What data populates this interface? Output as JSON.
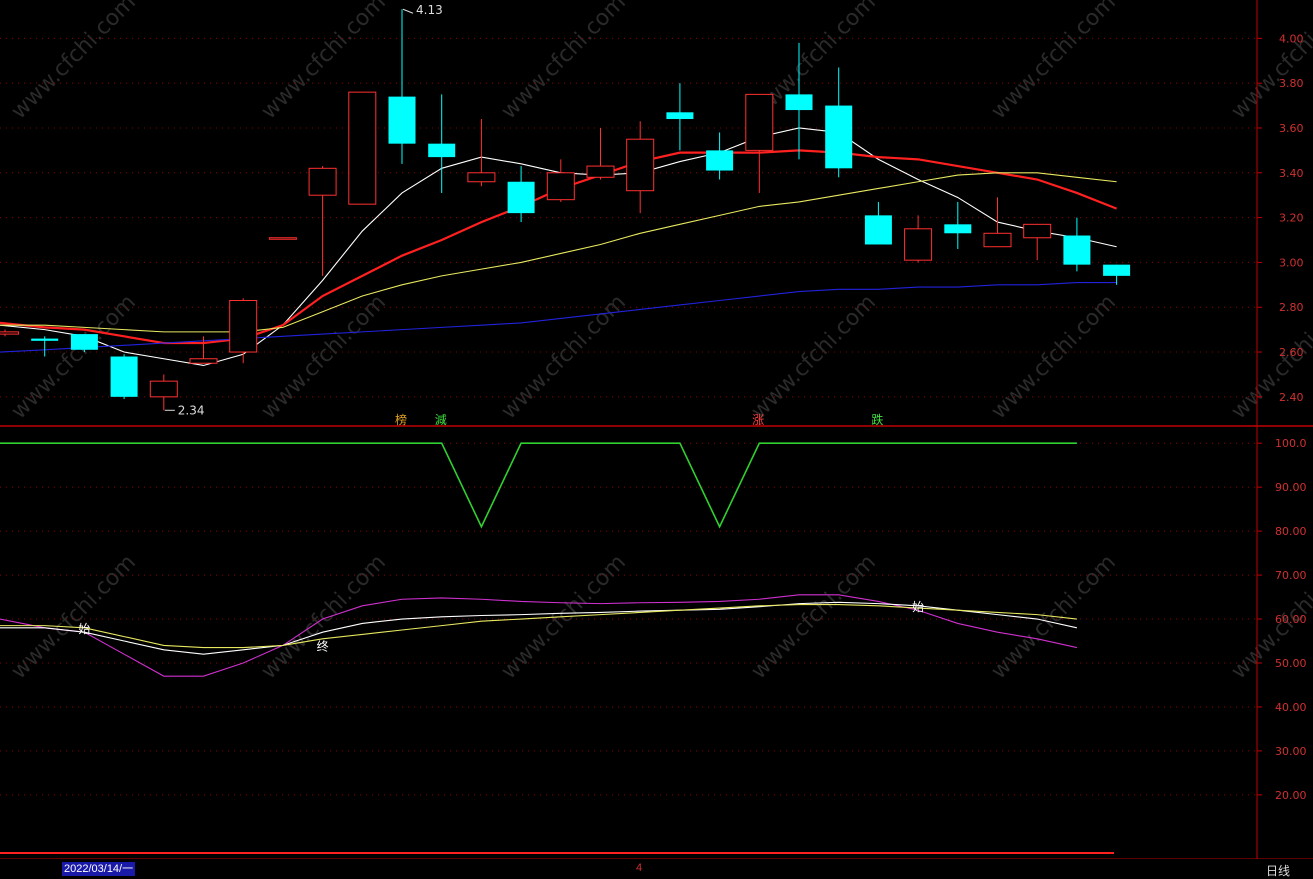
{
  "chart_data": {
    "type": "candlestick",
    "price_axis": {
      "ticks": [
        "4.00",
        "3.80",
        "3.60",
        "3.40",
        "3.20",
        "3.00",
        "2.80",
        "2.60",
        "2.40"
      ],
      "ylim": [
        2.31,
        4.14
      ]
    },
    "indicator_axis": {
      "ticks": [
        "100.0",
        "90.00",
        "80.00",
        "70.00",
        "60.00",
        "50.00",
        "40.00",
        "30.00",
        "20.00"
      ],
      "ylim": [
        7,
        103
      ]
    },
    "candles": [
      {
        "o": 2.68,
        "c": 2.69,
        "h": 2.7,
        "l": 2.67
      },
      {
        "o": 2.66,
        "c": 2.65,
        "h": 2.67,
        "l": 2.58
      },
      {
        "o": 2.68,
        "c": 2.61,
        "h": 2.68,
        "l": 2.6
      },
      {
        "o": 2.58,
        "c": 2.4,
        "h": 2.59,
        "l": 2.39
      },
      {
        "o": 2.4,
        "c": 2.47,
        "h": 2.5,
        "l": 2.34
      },
      {
        "o": 2.55,
        "c": 2.57,
        "h": 2.67,
        "l": 2.55
      },
      {
        "o": 2.6,
        "c": 2.83,
        "h": 2.84,
        "l": 2.55
      },
      {
        "o": 3.11,
        "c": 3.11,
        "h": 3.11,
        "l": 3.11
      },
      {
        "o": 3.3,
        "c": 3.42,
        "h": 3.43,
        "l": 2.94
      },
      {
        "o": 3.26,
        "c": 3.76,
        "h": 3.76,
        "l": 3.26
      },
      {
        "o": 3.74,
        "c": 3.53,
        "h": 4.13,
        "l": 3.44
      },
      {
        "o": 3.53,
        "c": 3.47,
        "h": 3.75,
        "l": 3.31
      },
      {
        "o": 3.36,
        "c": 3.4,
        "h": 3.64,
        "l": 3.34
      },
      {
        "o": 3.36,
        "c": 3.22,
        "h": 3.43,
        "l": 3.18
      },
      {
        "o": 3.28,
        "c": 3.4,
        "h": 3.46,
        "l": 3.27
      },
      {
        "o": 3.38,
        "c": 3.43,
        "h": 3.6,
        "l": 3.37
      },
      {
        "o": 3.32,
        "c": 3.55,
        "h": 3.63,
        "l": 3.22
      },
      {
        "o": 3.67,
        "c": 3.64,
        "h": 3.8,
        "l": 3.5
      },
      {
        "o": 3.5,
        "c": 3.41,
        "h": 3.58,
        "l": 3.37
      },
      {
        "o": 3.5,
        "c": 3.75,
        "h": 3.75,
        "l": 3.31
      },
      {
        "o": 3.75,
        "c": 3.68,
        "h": 3.98,
        "l": 3.46
      },
      {
        "o": 3.7,
        "c": 3.42,
        "h": 3.87,
        "l": 3.38
      },
      {
        "o": 3.21,
        "c": 3.08,
        "h": 3.27,
        "l": 3.08
      },
      {
        "o": 3.01,
        "c": 3.15,
        "h": 3.21,
        "l": 3.0
      },
      {
        "o": 3.17,
        "c": 3.13,
        "h": 3.27,
        "l": 3.06
      },
      {
        "o": 3.07,
        "c": 3.13,
        "h": 3.29,
        "l": 3.07
      },
      {
        "o": 3.11,
        "c": 3.17,
        "h": 3.17,
        "l": 3.01
      },
      {
        "o": 3.12,
        "c": 2.99,
        "h": 3.2,
        "l": 2.96
      },
      {
        "o": 2.99,
        "c": 2.94,
        "h": 2.99,
        "l": 2.9
      }
    ],
    "moving_averages": [
      {
        "color": "#ffffff",
        "values": [
          2.72,
          2.7,
          2.67,
          2.6,
          2.57,
          2.54,
          2.59,
          2.72,
          2.92,
          3.14,
          3.31,
          3.42,
          3.47,
          3.44,
          3.4,
          3.39,
          3.4,
          3.45,
          3.49,
          3.56,
          3.6,
          3.58,
          3.46,
          3.37,
          3.29,
          3.18,
          3.14,
          3.11,
          3.07
        ]
      },
      {
        "color": "#ff2020",
        "values": [
          2.73,
          2.71,
          2.7,
          2.67,
          2.64,
          2.64,
          2.66,
          2.72,
          2.85,
          2.94,
          3.03,
          3.1,
          3.18,
          3.25,
          3.33,
          3.39,
          3.45,
          3.49,
          3.49,
          3.49,
          3.5,
          3.49,
          3.47,
          3.46,
          3.43,
          3.4,
          3.37,
          3.31,
          3.24
        ]
      },
      {
        "color": "#e8e860",
        "values": [
          2.72,
          2.72,
          2.71,
          2.7,
          2.69,
          2.69,
          2.69,
          2.71,
          2.78,
          2.85,
          2.9,
          2.94,
          2.97,
          3.0,
          3.04,
          3.08,
          3.13,
          3.17,
          3.21,
          3.25,
          3.27,
          3.3,
          3.33,
          3.36,
          3.39,
          3.4,
          3.4,
          3.38,
          3.36
        ]
      },
      {
        "color": "#2222dd",
        "values": [
          2.6,
          2.61,
          2.62,
          2.63,
          2.64,
          2.65,
          2.66,
          2.67,
          2.68,
          2.69,
          2.7,
          2.71,
          2.72,
          2.73,
          2.75,
          2.77,
          2.79,
          2.81,
          2.83,
          2.85,
          2.87,
          2.88,
          2.88,
          2.89,
          2.89,
          2.9,
          2.9,
          2.91,
          2.91
        ]
      }
    ],
    "high_label": "4.13",
    "low_label": "2.34",
    "signals": [
      {
        "text": "榜",
        "index": 10,
        "color": "#e0a020"
      },
      {
        "text": "減",
        "index": 11,
        "color": "#40e040"
      },
      {
        "text": "涨",
        "index": 19,
        "color": "#ff4040"
      },
      {
        "text": "跌",
        "index": 22,
        "color": "#40e040"
      }
    ],
    "indicators": [
      {
        "color": "#30d030",
        "values": [
          100,
          100,
          100,
          100,
          100,
          100,
          100,
          100,
          100,
          100,
          100,
          100,
          81,
          100,
          100,
          100,
          100,
          100,
          81,
          100,
          100,
          100,
          100,
          100,
          100,
          100,
          100,
          100
        ]
      },
      {
        "color": "#d030d0",
        "values": [
          60,
          58,
          57,
          52,
          47,
          47,
          50,
          54,
          60,
          63,
          64.5,
          64.8,
          64.5,
          64,
          63.7,
          63.5,
          63.7,
          63.8,
          64,
          64.5,
          65.5,
          65.5,
          64,
          62,
          59,
          57,
          55.5,
          53.5
        ]
      },
      {
        "color": "#ffffff",
        "values": [
          58,
          58,
          57,
          55,
          53,
          52,
          53,
          54,
          57,
          59,
          60,
          60.5,
          60.8,
          61,
          61.3,
          61.5,
          61.8,
          62,
          62.2,
          62.8,
          63.5,
          63.8,
          63.5,
          63,
          62,
          61,
          60,
          58
        ]
      },
      {
        "color": "#e8e860",
        "values": [
          58.5,
          58.5,
          58,
          56,
          54,
          53.5,
          53.5,
          54,
          55.5,
          56.5,
          57.5,
          58.5,
          59.5,
          60,
          60.5,
          61,
          61.5,
          62,
          62.5,
          63,
          63.3,
          63.3,
          63,
          62.5,
          62,
          61.5,
          61,
          60
        ]
      }
    ],
    "indicator_marks": [
      {
        "text": "始",
        "index": 2,
        "value": 58
      },
      {
        "text": "终",
        "index": 8,
        "value": 54
      },
      {
        "text": "始",
        "index": 23,
        "value": 63
      }
    ]
  },
  "status_bar": {
    "date": "2022/03/14/一",
    "cursor_mark": "4",
    "period": "日线"
  },
  "watermark": "www.cfchi.com",
  "colors": {
    "up": "#ff3030",
    "down": "#00ffff",
    "axis": "#c00000",
    "grid": "#8a0000"
  }
}
